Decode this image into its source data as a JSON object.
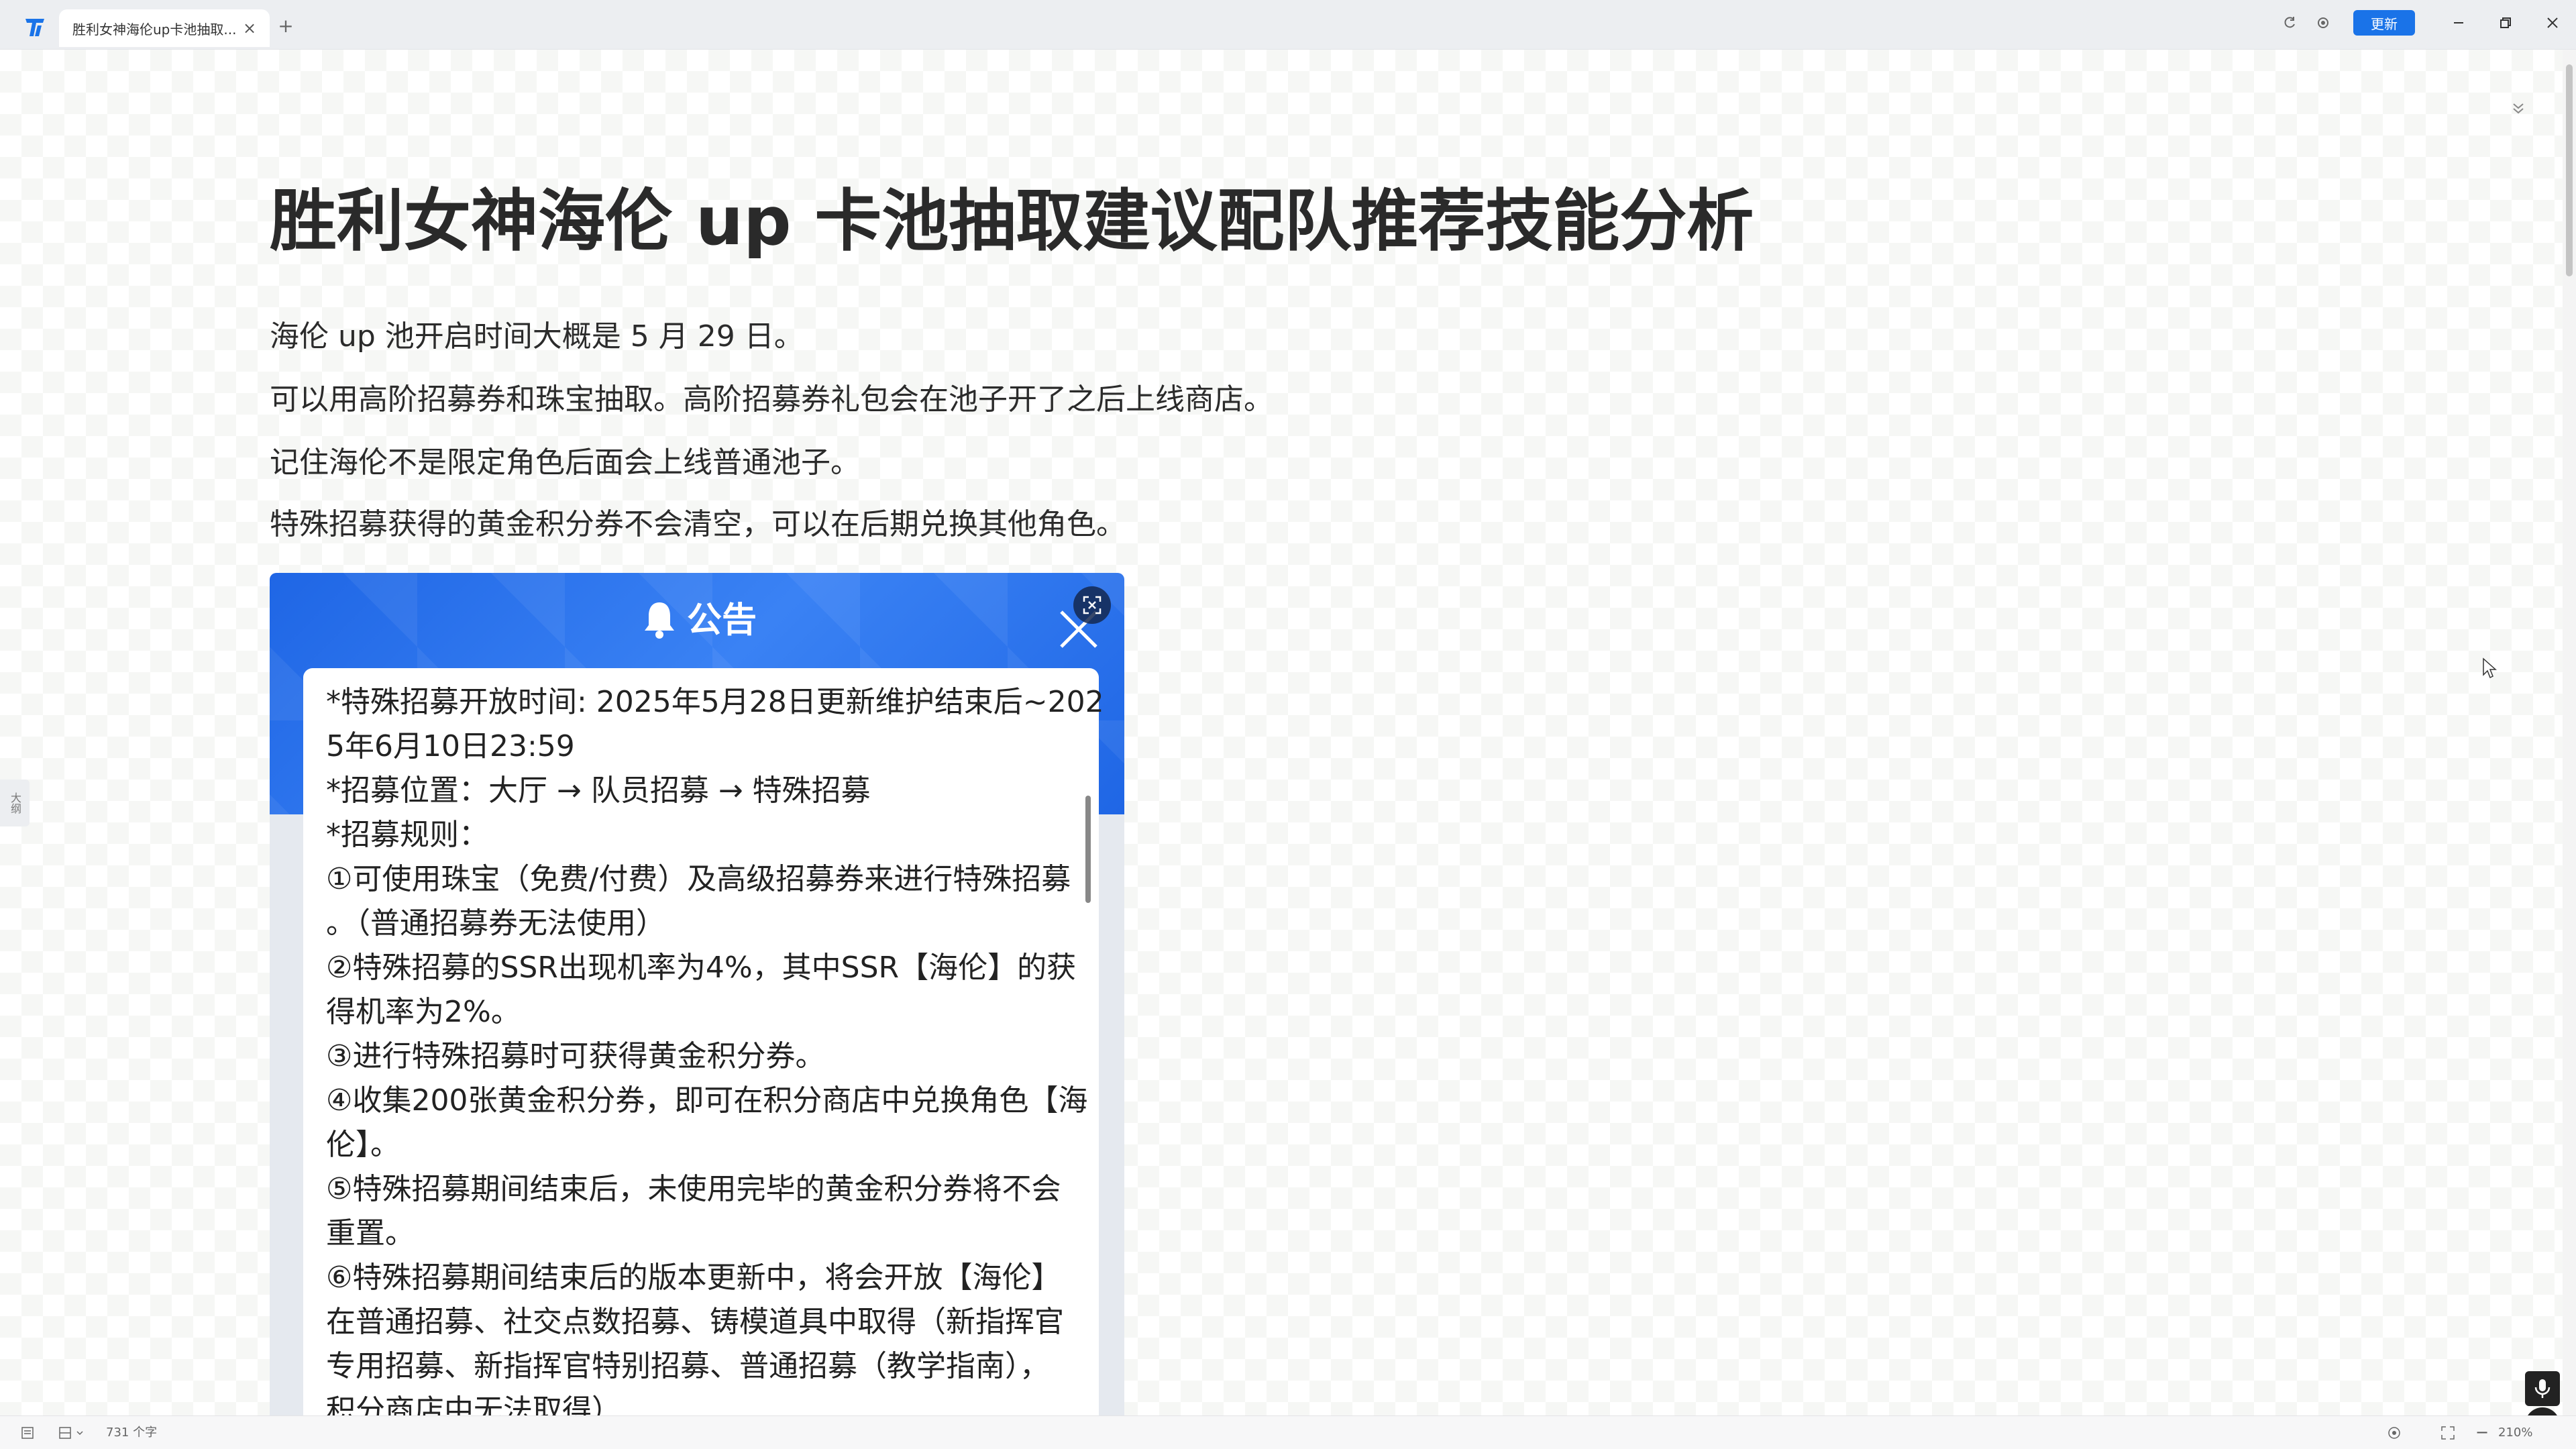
{
  "window": {
    "tab_title": "胜利女神海伦up卡池抽取...",
    "update_label": "更新"
  },
  "document": {
    "title": "胜利女神海伦 up 卡池抽取建议配队推荐技能分析",
    "paragraphs": [
      "海伦 up 池开启时间大概是 5 月 29 日。",
      "可以用高阶招募券和珠宝抽取。高阶招募券礼包会在池子开了之后上线商店。",
      "记住海伦不是限定角色后面会上线普通池子。",
      "特殊招募获得的黄金积分券不会清空，可以在后期兑换其他角色。"
    ]
  },
  "outline_tab_label": "大纲",
  "notice_image": {
    "heading": "公告",
    "lines": [
      "*特殊招募开放时间: 2025年5月28日更新维护结束后~202",
      "5年6月10日23:59",
      "*招募位置：大厅 → 队员招募 → 特殊招募",
      "*招募规则：",
      "①可使用珠宝（免费/付费）及高级招募券来进行特殊招募",
      "。（普通招募券无法使用）",
      "②特殊招募的SSR出现机率为4%，其中SSR【海伦】的获",
      "得机率为2%。",
      "③进行特殊招募时可获得黄金积分券。",
      "④收集200张黄金积分券，即可在积分商店中兑换角色【海",
      "伦】。",
      "⑤特殊招募期间结束后，未使用完毕的黄金积分券将不会",
      "重置。",
      "⑥特殊招募期间结束后的版本更新中，将会开放【海伦】",
      "在普通招募、社交点数招募、铸模道具中取得（新指挥官",
      "专用招募、新指挥官特别招募、普通招募（教学指南），",
      "积分商店中无法取得）"
    ]
  },
  "statusbar": {
    "word_count": "731 个字",
    "zoom": "210%"
  },
  "colors": {
    "accent": "#1a73e8",
    "notice_blue": "#1f66e5"
  }
}
